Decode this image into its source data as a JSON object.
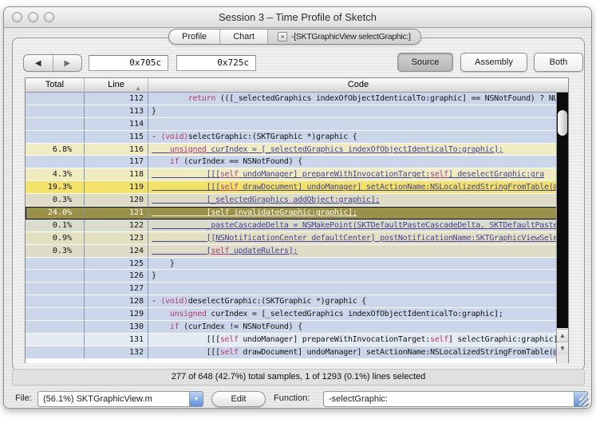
{
  "window": {
    "title": "Session 3 – Time Profile of Sketch"
  },
  "tabs": {
    "items": [
      {
        "label": "Profile"
      },
      {
        "label": "Chart"
      }
    ],
    "active": {
      "close_glyph": "×",
      "label": "-[SKTGraphicView selectGraphic:]"
    }
  },
  "toolbar": {
    "back_icon": "◀",
    "forward_icon": "▶",
    "address_start": "0x705c",
    "address_end": "0x725c",
    "source_label": "Source",
    "assembly_label": "Assembly",
    "both_label": "Both"
  },
  "table": {
    "columns": {
      "total": "Total",
      "line": "Line",
      "code": "Code"
    },
    "sort_icon": "▲",
    "colors": {
      "row_plain": "#ccd6ea",
      "row_hot_faint": "#d9dbcb",
      "row_hot_low": "#dedcc6",
      "row_hot_mid": "#e3dfc1",
      "row_hot_high": "#efecc2",
      "row_hot_max": "#f3e268",
      "row_selected": "#99914a",
      "keyword": "#b03a72",
      "sampled_text": "#43439e"
    },
    "rows": [
      {
        "total": "",
        "line": "112",
        "bg": "#ccd6ea",
        "underline": false,
        "selected": false,
        "code": [
          [
            "p",
            "        "
          ],
          [
            "k",
            "return"
          ],
          [
            "p",
            " (([_selectedGraphics indexOfObjectIdenticalTo:graphic] == NSNotFound) ? NU…"
          ]
        ]
      },
      {
        "total": "",
        "line": "113",
        "bg": "#ccd6ea",
        "underline": false,
        "selected": false,
        "code": [
          [
            "p",
            "}"
          ]
        ]
      },
      {
        "total": "",
        "line": "114",
        "bg": "#ccd6ea",
        "underline": false,
        "selected": false,
        "code": []
      },
      {
        "total": "",
        "line": "115",
        "bg": "#ccd6ea",
        "underline": false,
        "selected": false,
        "code": [
          [
            "p",
            "- "
          ],
          [
            "k",
            "(void)"
          ],
          [
            "p",
            "selectGraphic:(SKTGraphic *)graphic {"
          ]
        ]
      },
      {
        "total": "6.8%",
        "line": "116",
        "bg": "#efecc2",
        "underline": true,
        "selected": false,
        "code": [
          [
            "p",
            "    "
          ],
          [
            "k",
            "unsigned"
          ],
          [
            "p",
            " curIndex = [_selectedGraphics indexOfObjectIdenticalTo:graphic];"
          ]
        ]
      },
      {
        "total": "",
        "line": "117",
        "bg": "#ccd6ea",
        "underline": false,
        "selected": false,
        "code": [
          [
            "p",
            "    "
          ],
          [
            "k",
            "if"
          ],
          [
            "p",
            " (curIndex == NSNotFound) {"
          ]
        ]
      },
      {
        "total": "4.3%",
        "line": "118",
        "bg": "#efecc2",
        "underline": true,
        "selected": false,
        "code": [
          [
            "p",
            "            [[["
          ],
          [
            "k",
            "self"
          ],
          [
            "p",
            " undoManager] prepareWithInvocationTarget:"
          ],
          [
            "k",
            "self"
          ],
          [
            "p",
            "] deselectGraphic:gra"
          ]
        ]
      },
      {
        "total": "19.3%",
        "line": "119",
        "bg": "#f3e268",
        "underline": true,
        "selected": false,
        "code": [
          [
            "p",
            "            [[["
          ],
          [
            "k",
            "self"
          ],
          [
            "p",
            " drawDocument] undoManager] setActionName:NSLocalizedStringFromTable(@…"
          ]
        ]
      },
      {
        "total": "0.3%",
        "line": "120",
        "bg": "#dedcc6",
        "underline": true,
        "selected": false,
        "code": [
          [
            "p",
            "            [_selectedGraphics addObject:graphic];"
          ]
        ]
      },
      {
        "total": "24.0%",
        "line": "121",
        "bg": "#99914a",
        "underline": true,
        "selected": true,
        "code": [
          [
            "p",
            "            ["
          ],
          [
            "k",
            "self"
          ],
          [
            "p",
            " invalidateGraphic:graphic];"
          ]
        ]
      },
      {
        "total": "0.1%",
        "line": "122",
        "bg": "#d9dbcb",
        "underline": true,
        "selected": false,
        "code": [
          [
            "p",
            "            _pasteCascadeDelta = NSMakePoint(SKTDefaultPasteCascadeDelta, SKTDefaultPaste…"
          ]
        ]
      },
      {
        "total": "0.9%",
        "line": "123",
        "bg": "#e3dfc1",
        "underline": true,
        "selected": false,
        "code": [
          [
            "p",
            "            [[NSNotificationCenter defaultCenter] postNotificationName:SKTGraphicViewSele…"
          ]
        ]
      },
      {
        "total": "0.3%",
        "line": "124",
        "bg": "#dedcc6",
        "underline": true,
        "selected": false,
        "code": [
          [
            "p",
            "            ["
          ],
          [
            "k",
            "self"
          ],
          [
            "p",
            " updateRulers];"
          ]
        ]
      },
      {
        "total": "",
        "line": "125",
        "bg": "#ccd6ea",
        "underline": false,
        "selected": false,
        "code": [
          [
            "p",
            "    }"
          ]
        ]
      },
      {
        "total": "",
        "line": "126",
        "bg": "#ccd6ea",
        "underline": false,
        "selected": false,
        "code": [
          [
            "p",
            "}"
          ]
        ]
      },
      {
        "total": "",
        "line": "127",
        "bg": "#ccd6ea",
        "underline": false,
        "selected": false,
        "code": []
      },
      {
        "total": "",
        "line": "128",
        "bg": "#ccd6ea",
        "underline": false,
        "selected": false,
        "code": [
          [
            "p",
            "- "
          ],
          [
            "k",
            "(void)"
          ],
          [
            "p",
            "deselectGraphic:(SKTGraphic *)graphic {"
          ]
        ]
      },
      {
        "total": "",
        "line": "129",
        "bg": "#ccd6ea",
        "underline": false,
        "selected": false,
        "code": [
          [
            "p",
            "    "
          ],
          [
            "k",
            "unsigned"
          ],
          [
            "p",
            " curIndex = [_selectedGraphics indexOfObjectIdenticalTo:graphic];"
          ]
        ]
      },
      {
        "total": "",
        "line": "130",
        "bg": "#ccd6ea",
        "underline": false,
        "selected": false,
        "code": [
          [
            "p",
            "    "
          ],
          [
            "k",
            "if"
          ],
          [
            "p",
            " (curIndex != NSNotFound) {"
          ]
        ]
      },
      {
        "total": "",
        "line": "131",
        "bg": "#e4eaf4",
        "underline": false,
        "selected": false,
        "code": [
          [
            "p",
            "            [[["
          ],
          [
            "k",
            "self"
          ],
          [
            "p",
            " undoManager] prepareWithInvocationTarget:"
          ],
          [
            "k",
            "self"
          ],
          [
            "p",
            "] selectGraphic:graphic];"
          ]
        ]
      },
      {
        "total": "",
        "line": "132",
        "bg": "#ccd6ea",
        "underline": false,
        "selected": false,
        "code": [
          [
            "p",
            "            [[["
          ],
          [
            "k",
            "self"
          ],
          [
            "p",
            " drawDocument] undoManager] setActionName:NSLocalizedStringFromTable(@…"
          ]
        ]
      }
    ]
  },
  "scrollbar": {
    "up_icon": "▲",
    "down_icon": "▼"
  },
  "status": {
    "text": "277 of 648 (42.7%) total samples, 1 of 1293 (0.1%) lines selected"
  },
  "footer": {
    "file_label": "File:",
    "file_value": "(56.1%) SKTGraphicView.m",
    "edit_label": "Edit",
    "function_label": "Function:",
    "function_value": "-selectGraphic:",
    "dropdown_icon": "▼"
  }
}
